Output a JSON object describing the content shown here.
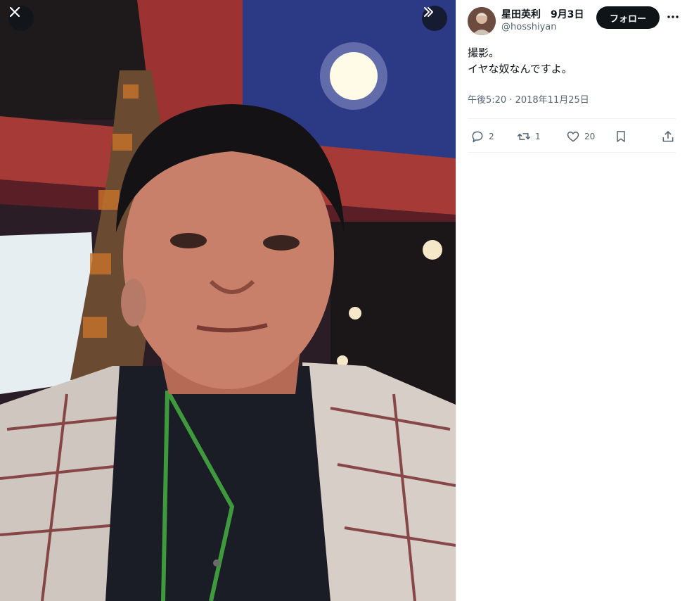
{
  "author": {
    "name": "星田英利",
    "date": "9月3日",
    "handle": "@hosshiyan"
  },
  "follow_label": "フォロー",
  "tweet": {
    "text": "撮影。\nイヤな奴なんですよ。",
    "timestamp": "午後5:20 · 2018年11月25日"
  },
  "metrics": {
    "replies": "2",
    "retweets": "1",
    "likes": "20"
  },
  "icons": {
    "close": "close-icon",
    "expand": "chevrons-right-icon",
    "more": "more-horizontal-icon",
    "reply": "reply-icon",
    "retweet": "retweet-icon",
    "like": "heart-icon",
    "bookmark": "bookmark-icon",
    "share": "share-icon"
  },
  "colors": {
    "text": "#0f1419",
    "secondary_text": "#536471",
    "follow_button_bg": "#0f1419",
    "divider": "#eff3f4"
  }
}
